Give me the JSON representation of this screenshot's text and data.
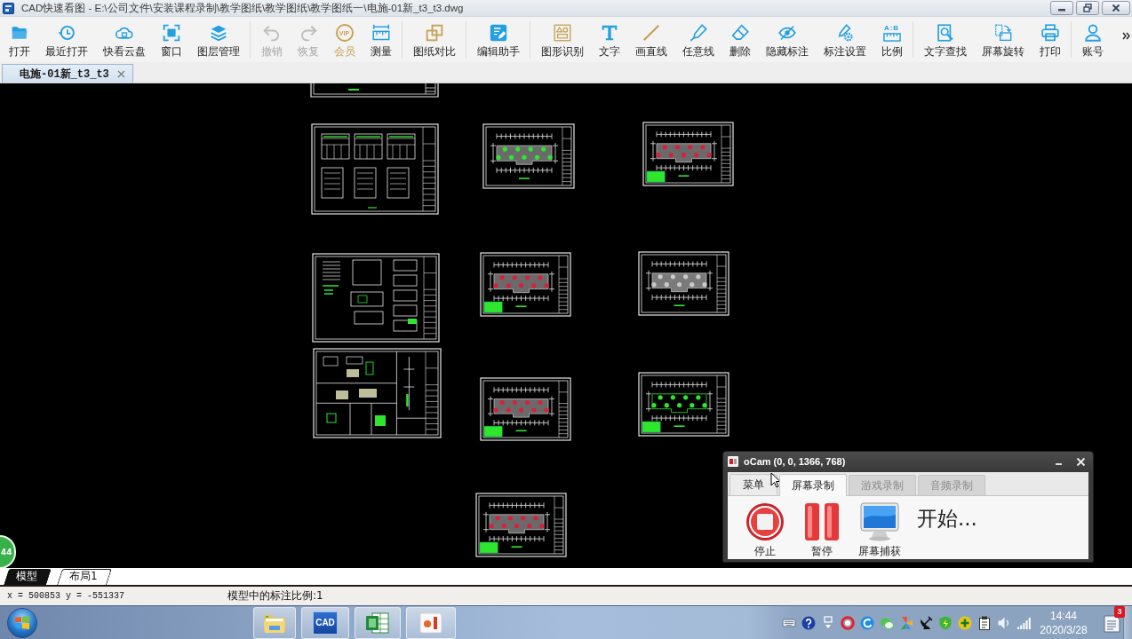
{
  "window": {
    "title": "CAD快速看图 - E:\\公司文件\\安装课程录制\\教学图纸\\教学图纸\\教学图纸一\\电施-01新_t3_t3.dwg"
  },
  "toolbar": {
    "groups": [
      [
        {
          "label": "打开",
          "kind": "tool",
          "disabled": false
        },
        {
          "label": "最近打开",
          "kind": "tool",
          "disabled": false
        },
        {
          "label": "快看云盘",
          "kind": "tool",
          "disabled": false
        },
        {
          "label": "窗口",
          "kind": "tool",
          "disabled": false
        },
        {
          "label": "图层管理",
          "kind": "tool",
          "disabled": false
        }
      ],
      [
        {
          "label": "撤销",
          "kind": "tool",
          "disabled": true
        },
        {
          "label": "恢复",
          "kind": "tool",
          "disabled": true
        },
        {
          "label": "会员",
          "kind": "premium",
          "icon_text": "VIP",
          "disabled": false
        },
        {
          "label": "测量",
          "kind": "tool",
          "disabled": false
        }
      ],
      [
        {
          "label": "图纸对比",
          "kind": "tool",
          "disabled": false
        }
      ],
      [
        {
          "label": "编辑助手",
          "kind": "tool",
          "disabled": false
        }
      ],
      [
        {
          "label": "图形识别",
          "kind": "tool",
          "disabled": false
        },
        {
          "label": "文字",
          "kind": "tool",
          "disabled": false
        },
        {
          "label": "画直线",
          "kind": "tool",
          "disabled": false
        },
        {
          "label": "任意线",
          "kind": "tool",
          "disabled": false
        },
        {
          "label": "删除",
          "kind": "tool",
          "disabled": false
        },
        {
          "label": "隐藏标注",
          "kind": "tool",
          "disabled": false
        },
        {
          "label": "标注设置",
          "kind": "tool",
          "disabled": false
        },
        {
          "label": "比例",
          "kind": "ratio",
          "icon_text": "A:B",
          "disabled": false
        }
      ],
      [
        {
          "label": "文字查找",
          "kind": "tool",
          "disabled": false
        },
        {
          "label": "屏幕旋转",
          "kind": "tool",
          "disabled": false
        },
        {
          "label": "打印",
          "kind": "tool",
          "disabled": false
        }
      ],
      [
        {
          "label": "账号",
          "kind": "tool",
          "disabled": false
        }
      ]
    ]
  },
  "document_tabs": [
    {
      "label": "电施-01新_t3_t3",
      "selected": true
    }
  ],
  "canvas": {
    "badge": "44"
  },
  "recorder": {
    "title": "oCam (0, 0, 1366, 768)",
    "menu_button": "菜单",
    "tabs": [
      {
        "label": "屏幕录制",
        "selected": true
      },
      {
        "label": "游戏录制",
        "selected": false
      },
      {
        "label": "音频录制",
        "selected": false
      }
    ],
    "buttons": [
      {
        "label": "停止",
        "kind": "stop"
      },
      {
        "label": "暂停",
        "kind": "pause"
      },
      {
        "label": "屏幕捕获",
        "kind": "capture"
      }
    ],
    "status": "开始..."
  },
  "layout_tabs": [
    {
      "label": "模型",
      "selected": true
    },
    {
      "label": "布局1",
      "selected": false
    }
  ],
  "status_bar": {
    "coordinates": "x = 500853 y = -551337",
    "scale": "模型中的标注比例:1"
  },
  "taskbar": {
    "apps": [
      {
        "kind": "folder"
      },
      {
        "kind": "cad",
        "text": "CAD"
      },
      {
        "kind": "spreadsheet"
      },
      {
        "kind": "slides"
      }
    ],
    "time": "14:44",
    "date": "2020/3/28",
    "notification_count": "3"
  }
}
